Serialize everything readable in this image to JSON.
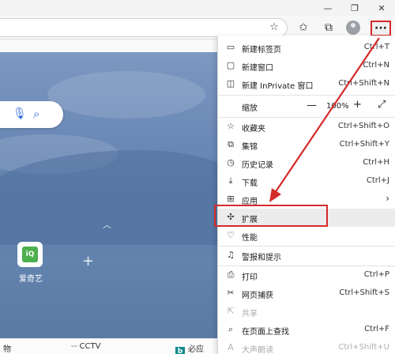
{
  "window": {
    "minimize": "—",
    "restore": "❐",
    "close": "✕"
  },
  "toolbar": {
    "favorite_icon": "star-add-icon",
    "more": "···",
    "accent": "#d42a2a"
  },
  "page": {
    "tile_label": "爱奇艺",
    "tile_icon_text": "iQ",
    "bottom_items": [
      "物",
      "CCTV",
      "必应"
    ]
  },
  "menu": {
    "items": [
      {
        "label": "新建标签页",
        "shortcut": "Ctrl+T",
        "icon": "new-tab-icon"
      },
      {
        "label": "新建窗口",
        "shortcut": "Ctrl+N",
        "icon": "new-window-icon"
      },
      {
        "label": "新建 InPrivate 窗口",
        "shortcut": "Ctrl+Shift+N",
        "icon": "inprivate-icon"
      },
      {
        "label": "缩放",
        "zoom_value": "100%",
        "minus": "—",
        "plus": "+",
        "icon": "fullscreen-icon"
      },
      {
        "label": "收藏夹",
        "shortcut": "Ctrl+Shift+O",
        "icon": "favorites-icon"
      },
      {
        "label": "集锦",
        "shortcut": "Ctrl+Shift+Y",
        "icon": "collections-icon"
      },
      {
        "label": "历史记录",
        "shortcut": "Ctrl+H",
        "icon": "history-icon"
      },
      {
        "label": "下载",
        "shortcut": "Ctrl+J",
        "icon": "download-icon"
      },
      {
        "label": "应用",
        "shortcut": "",
        "icon": "apps-icon"
      },
      {
        "label": "扩展",
        "shortcut": "",
        "icon": "extensions-icon"
      },
      {
        "label": "性能",
        "shortcut": "",
        "icon": "performance-icon"
      },
      {
        "label": "警报和提示",
        "shortcut": "",
        "icon": "alerts-icon"
      },
      {
        "label": "打印",
        "shortcut": "Ctrl+P",
        "icon": "print-icon"
      },
      {
        "label": "网页捕获",
        "shortcut": "Ctrl+Shift+S",
        "icon": "web-capture-icon"
      },
      {
        "label": "共享",
        "shortcut": "",
        "icon": "share-icon"
      },
      {
        "label": "在页面上查找",
        "shortcut": "Ctrl+F",
        "icon": "find-icon"
      },
      {
        "label": "大声朗读",
        "shortcut": "Ctrl+Shift+U",
        "icon": "read-aloud-icon"
      }
    ]
  }
}
